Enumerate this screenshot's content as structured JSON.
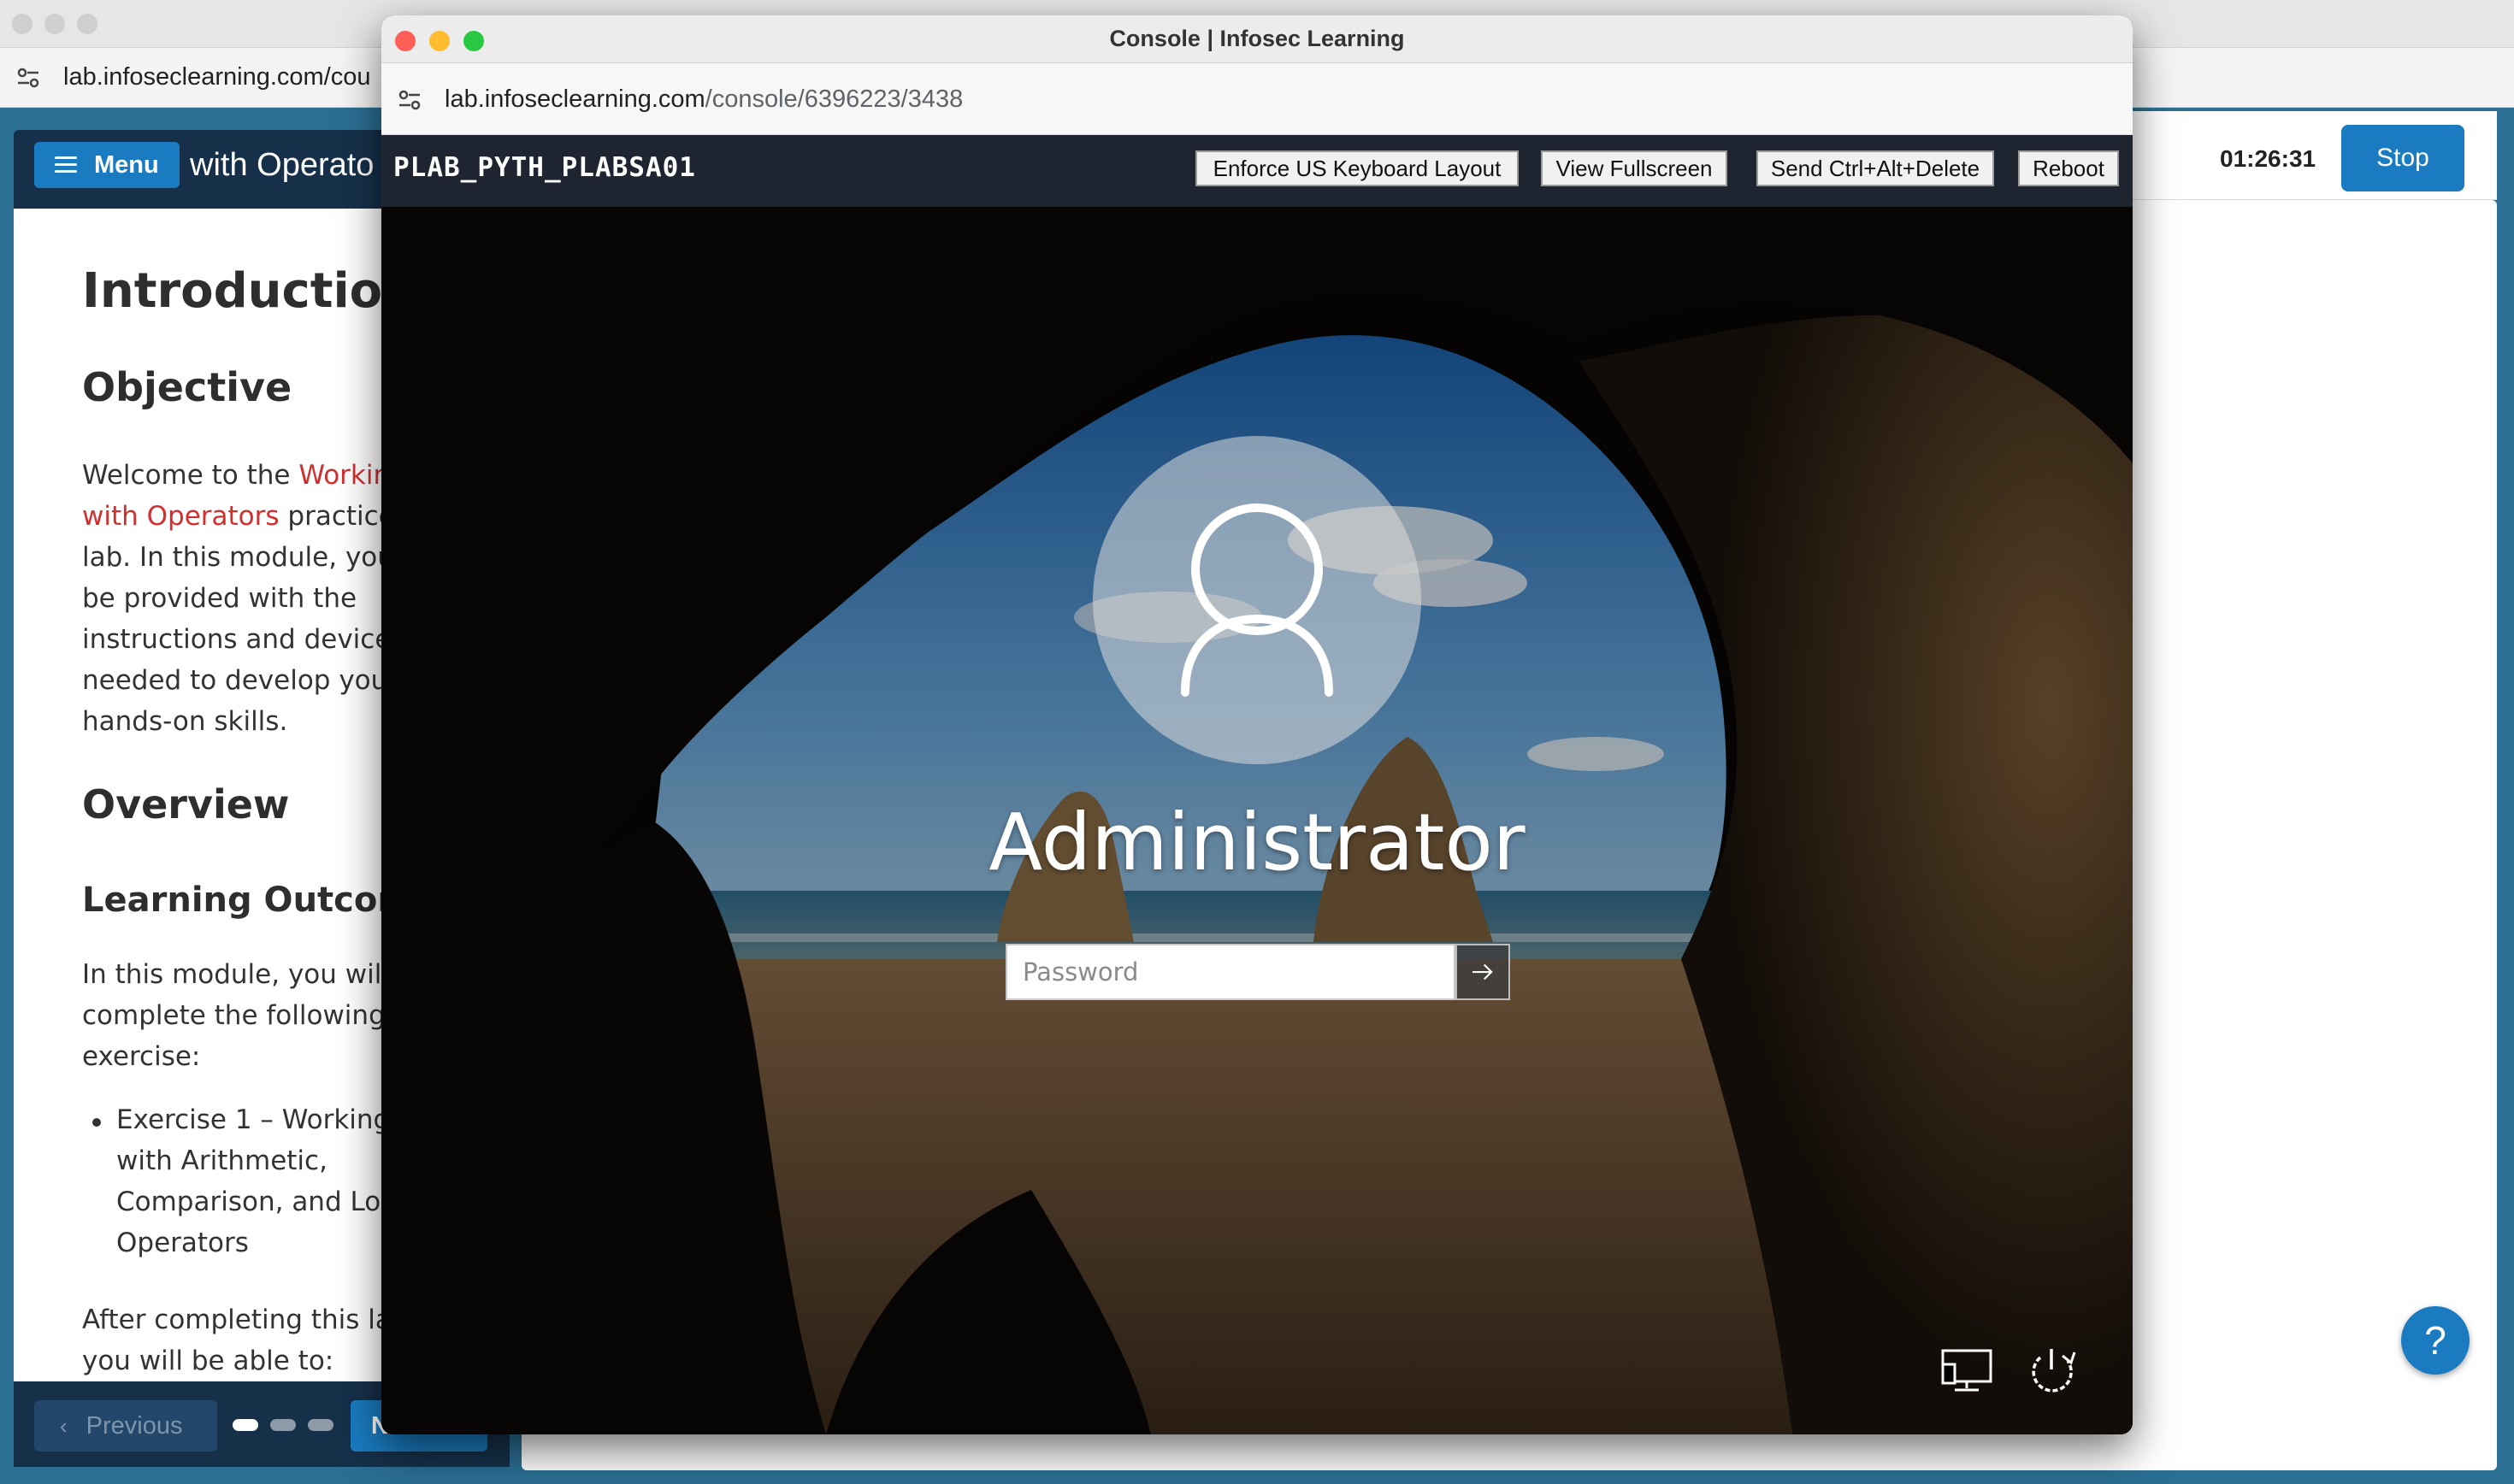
{
  "background_window": {
    "url": "lab.infoseclearning.com/cou",
    "menu_label": "Menu",
    "lab_title_partial": "with Operato",
    "timer": "01:26:31",
    "stop_label": "Stop",
    "help_label": "?"
  },
  "instructions": {
    "heading": "Introduction",
    "objective_heading": "Objective",
    "objective_lines": [
      {
        "pre": "Welcome to the ",
        "link": "Workin",
        "post": ""
      },
      {
        "pre": "",
        "link": "with Operators",
        "post": " practice"
      },
      {
        "pre": "lab. In this module, you",
        "link": "",
        "post": ""
      },
      {
        "pre": "be provided with the",
        "link": "",
        "post": ""
      },
      {
        "pre": "instructions and device",
        "link": "",
        "post": ""
      },
      {
        "pre": "needed to develop your",
        "link": "",
        "post": ""
      },
      {
        "pre": "hands-on skills.",
        "link": "",
        "post": ""
      }
    ],
    "overview_heading": "Overview",
    "outcomes_heading": "Learning Outcom",
    "module_lines": [
      "In this module, you will",
      "complete the following",
      "exercise:"
    ],
    "exercise_lines": [
      "Exercise 1 – Working",
      "with Arithmetic,",
      "Comparison, and Log",
      "Operators"
    ],
    "after_lines": [
      "After completing this la",
      "you will be able to:"
    ]
  },
  "footer": {
    "previous_label": "Previous",
    "next_label": "N",
    "page_dots": 3,
    "current_page": 1
  },
  "console_window": {
    "title": "Console | Infosec Learning",
    "url_host": "lab.infoseclearning.com",
    "url_path": "/console/6396223/3438",
    "machine_name": "PLAB_PYTH_PLABSA01",
    "toolbar": {
      "keyboard_label": "Enforce US Keyboard Layout",
      "fullscreen_label": "View Fullscreen",
      "ctrl_alt_del_label": "Send Ctrl+Alt+Delete",
      "reboot_label": "Reboot"
    },
    "login": {
      "username": "Administrator",
      "password_placeholder": "Password"
    },
    "icons": {
      "network": "network-icon",
      "power": "power-icon",
      "user": "user-icon"
    }
  },
  "colors": {
    "accent": "#1a7bc0",
    "header_dark": "#16304a",
    "link_red": "#d22f2f",
    "console_toolbar": "#1e2430"
  }
}
